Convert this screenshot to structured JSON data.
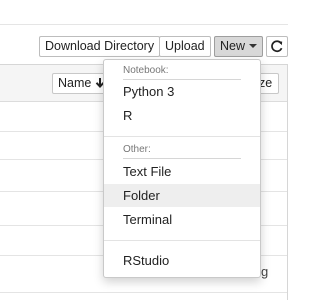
{
  "toolbar": {
    "download_directory_label": "Download Directory",
    "upload_label": "Upload",
    "new_label": "New",
    "refresh_icon": "refresh-icon"
  },
  "file_list": {
    "columns": {
      "name": "Name",
      "name_sort_icon": "arrow-down-icon",
      "size_partial": "ze"
    },
    "trailing_text": "g"
  },
  "new_menu": {
    "notebook_header": "Notebook:",
    "notebook_items": [
      "Python 3",
      "R"
    ],
    "other_header": "Other:",
    "other_items": [
      "Text File",
      "Folder",
      "Terminal"
    ],
    "extra_items": [
      "RStudio"
    ],
    "highlighted_item": "Folder"
  }
}
